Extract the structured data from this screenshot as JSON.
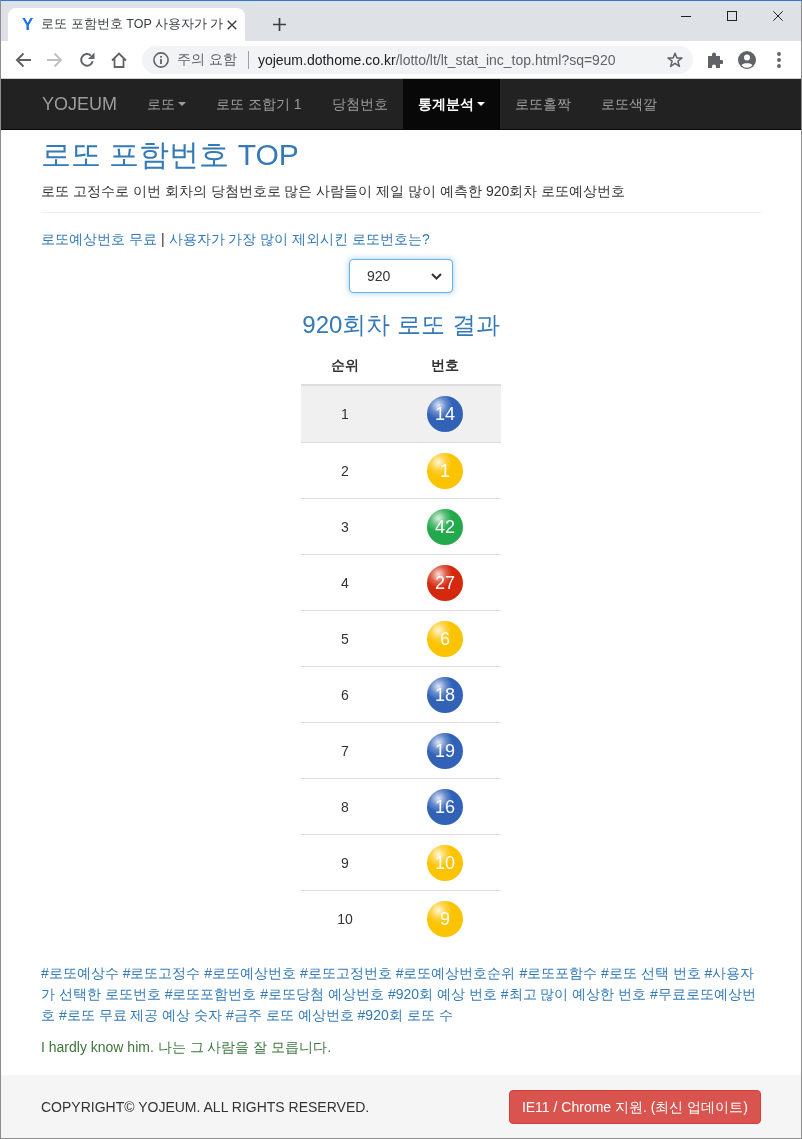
{
  "browser": {
    "tab": {
      "icon": "Y",
      "title": "로또 포함번호 TOP 사용자가 가",
      "selected": true
    },
    "forward_disabled": true,
    "address_bar": {
      "security_label": "주의 요함",
      "host": "yojeum.dothome.co.kr",
      "path": "/lotto/lt/lt_stat_inc_top.html?sq=920"
    }
  },
  "navbar": {
    "brand": "YOJEUM",
    "items": [
      {
        "label": "로또",
        "dropdown": true,
        "selected": false
      },
      {
        "label": "로또 조합기 1",
        "dropdown": false,
        "selected": false
      },
      {
        "label": "당첨번호",
        "dropdown": false,
        "selected": false
      },
      {
        "label": "통계분석",
        "dropdown": true,
        "selected": true
      },
      {
        "label": "로또홀짝",
        "dropdown": false,
        "selected": false
      },
      {
        "label": "로또색깔",
        "dropdown": false,
        "selected": false
      }
    ]
  },
  "page": {
    "title": "로또 포함번호 TOP",
    "description": "로또 고정수로 이번 회차의 당첨번호로 많은 사람들이 제일 많이 예측한 920회차 로또예상번호",
    "links": [
      "로또예상번호 무료",
      "사용자가 가장 많이 제외시킨 로또번호는?"
    ],
    "link_separator": "|",
    "round_select": {
      "value": "920",
      "focused": true
    },
    "result_title": "920회차 로또 결과",
    "table": {
      "columns": [
        "순위",
        "번호"
      ],
      "rows": [
        {
          "rank": "1",
          "number": "14",
          "color": "#3162b8",
          "highlighted": true
        },
        {
          "rank": "2",
          "number": "1",
          "color": "#fcc300",
          "highlighted": false
        },
        {
          "rank": "3",
          "number": "42",
          "color": "#21a94b",
          "highlighted": false
        },
        {
          "rank": "4",
          "number": "27",
          "color": "#d5290f",
          "highlighted": false
        },
        {
          "rank": "5",
          "number": "6",
          "color": "#fcc300",
          "highlighted": false
        },
        {
          "rank": "6",
          "number": "18",
          "color": "#3162b8",
          "highlighted": false
        },
        {
          "rank": "7",
          "number": "19",
          "color": "#3162b8",
          "highlighted": false
        },
        {
          "rank": "8",
          "number": "16",
          "color": "#3162b8",
          "highlighted": false
        },
        {
          "rank": "9",
          "number": "10",
          "color": "#fcc300",
          "highlighted": false
        },
        {
          "rank": "10",
          "number": "9",
          "color": "#fcc300",
          "highlighted": false
        }
      ]
    },
    "tags": "#로또예상수 #로또고정수 #로또예상번호 #로또고정번호 #로또예상번호순위 #로또포함수 #로또 선택 번호 #사용자가 선택한 로또번호 #로또포함번호 #로또당첨 예상번호 #920회 예상 번호 #최고 많이 예상한 번호 #무료로또예상번호 #로또 무료 제공 예상 숫자 #금주 로또 예상번호 #920회 로또 수",
    "note": "I hardly know him. 나는 그 사람을 잘 모릅니다."
  },
  "footer": {
    "copyright": "COPYRIGHT© YOJEUM. ALL RIGHTS RESERVED.",
    "button": "IE11 / Chrome 지원. (최신 업데이트)"
  }
}
